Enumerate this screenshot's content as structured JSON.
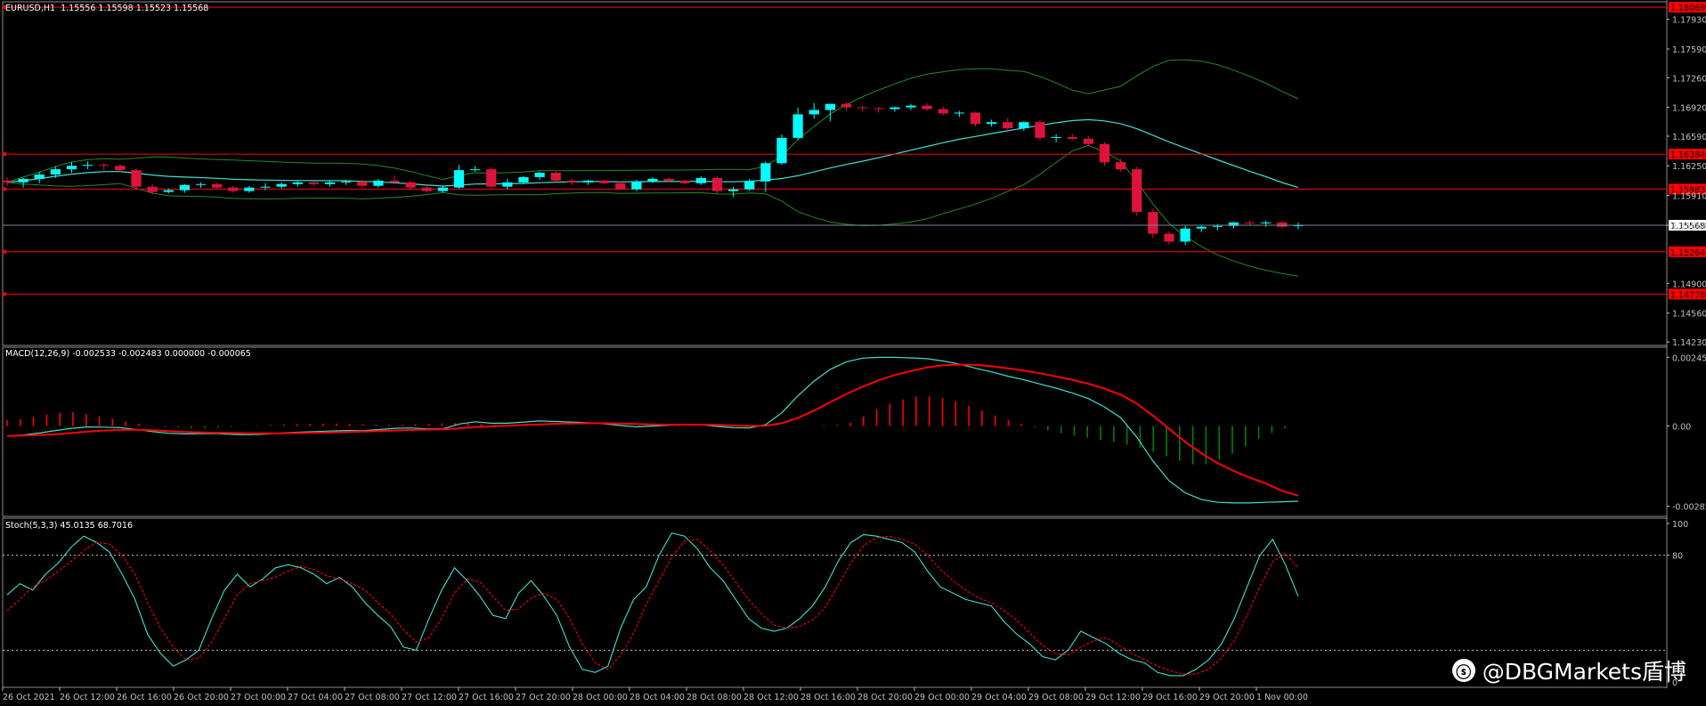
{
  "header": {
    "symbol_line": "EURUSD,H1  1.15556 1.15598 1.15523 1.15568",
    "macd_line": "MACD(12,26,9) -0.002533 -0.002483 0.000000 -0.000065",
    "stoch_line": "Stoch(5,3,3) 45.0135 68.7016"
  },
  "watermark": {
    "text": "@DBGMarkets盾博",
    "logo": "weibo-icon"
  },
  "colors": {
    "bull": "#00ffff",
    "bear": "#dc143c",
    "bands": "#228b22",
    "mid": "#40e0d0",
    "level": "#ff0000",
    "macd_hist_pos": "#ff0000",
    "macd_hist_neg": "#008000",
    "stoch_main": "#40e0d0",
    "stoch_signal": "#ff0000",
    "axis": "#c0c0c0"
  },
  "chart_data": [
    {
      "type": "candlestick",
      "title": "EURUSD,H1",
      "ylim": [
        1.1423,
        1.1807
      ],
      "y_ticks": [
        "1.17930",
        "1.17590",
        "1.17260",
        "1.16920",
        "1.16590",
        "1.16250",
        "1.15910",
        "1.15568",
        "1.14900",
        "1.14560",
        "1.14230"
      ],
      "price_label": "1.15568",
      "horizontal_levels": [
        "1.18069",
        "1.16384",
        "1.15983",
        "1.15264",
        "1.14778"
      ],
      "x_tick_labels": [
        "26 Oct 2021",
        "26 Oct 12:00",
        "26 Oct 16:00",
        "26 Oct 20:00",
        "27 Oct 00:00",
        "27 Oct 04:00",
        "27 Oct 08:00",
        "27 Oct 12:00",
        "27 Oct 16:00",
        "27 Oct 20:00",
        "28 Oct 00:00",
        "28 Oct 04:00",
        "28 Oct 08:00",
        "28 Oct 12:00",
        "28 Oct 16:00",
        "28 Oct 20:00",
        "29 Oct 00:00",
        "29 Oct 04:00",
        "29 Oct 08:00",
        "29 Oct 12:00",
        "29 Oct 16:00",
        "29 Oct 20:00",
        "1 Nov 00:00"
      ],
      "ohlc": [
        [
          1.1608,
          1.1612,
          1.1602,
          1.1606
        ],
        [
          1.1606,
          1.1611,
          1.16,
          1.161
        ],
        [
          1.161,
          1.1618,
          1.1605,
          1.1615
        ],
        [
          1.1615,
          1.1624,
          1.1611,
          1.1621
        ],
        [
          1.1621,
          1.1629,
          1.1617,
          1.1625
        ],
        [
          1.1625,
          1.163,
          1.1621,
          1.1626
        ],
        [
          1.1626,
          1.1628,
          1.162,
          1.1625
        ],
        [
          1.1625,
          1.1627,
          1.1618,
          1.162
        ],
        [
          1.162,
          1.1622,
          1.1598,
          1.1601
        ],
        [
          1.1601,
          1.1604,
          1.1592,
          1.1595
        ],
        [
          1.1595,
          1.1599,
          1.1593,
          1.1597
        ],
        [
          1.1597,
          1.1604,
          1.1594,
          1.1603
        ],
        [
          1.1603,
          1.1606,
          1.16,
          1.1604
        ],
        [
          1.1604,
          1.1606,
          1.1598,
          1.16
        ],
        [
          1.16,
          1.1602,
          1.1594,
          1.1596
        ],
        [
          1.1596,
          1.1602,
          1.1594,
          1.16
        ],
        [
          1.16,
          1.1605,
          1.1597,
          1.1601
        ],
        [
          1.1601,
          1.1606,
          1.1599,
          1.1604
        ],
        [
          1.1604,
          1.1608,
          1.1601,
          1.1606
        ],
        [
          1.1606,
          1.1608,
          1.1602,
          1.1604
        ],
        [
          1.1604,
          1.1608,
          1.1601,
          1.1606
        ],
        [
          1.1606,
          1.1609,
          1.1603,
          1.1607
        ],
        [
          1.1607,
          1.1609,
          1.16,
          1.1602
        ],
        [
          1.1602,
          1.161,
          1.16,
          1.1608
        ],
        [
          1.1608,
          1.1614,
          1.1604,
          1.1606
        ],
        [
          1.1606,
          1.1608,
          1.1598,
          1.16
        ],
        [
          1.16,
          1.1603,
          1.1594,
          1.1596
        ],
        [
          1.1596,
          1.1602,
          1.1594,
          1.16
        ],
        [
          1.16,
          1.1626,
          1.1599,
          1.162
        ],
        [
          1.162,
          1.1625,
          1.1618,
          1.1621
        ],
        [
          1.1621,
          1.1623,
          1.1599,
          1.1601
        ],
        [
          1.1601,
          1.161,
          1.1598,
          1.1606
        ],
        [
          1.1606,
          1.1613,
          1.1604,
          1.1612
        ],
        [
          1.1612,
          1.1618,
          1.1609,
          1.1617
        ],
        [
          1.1617,
          1.1618,
          1.1606,
          1.1608
        ],
        [
          1.1608,
          1.161,
          1.1603,
          1.1606
        ],
        [
          1.1606,
          1.1609,
          1.1603,
          1.1608
        ],
        [
          1.1608,
          1.1609,
          1.1604,
          1.1605
        ],
        [
          1.1605,
          1.1607,
          1.1597,
          1.1598
        ],
        [
          1.1598,
          1.1609,
          1.1596,
          1.1607
        ],
        [
          1.1607,
          1.1612,
          1.1605,
          1.161
        ],
        [
          1.161,
          1.1612,
          1.1606,
          1.1608
        ],
        [
          1.1608,
          1.1609,
          1.1604,
          1.1605
        ],
        [
          1.1605,
          1.1613,
          1.1603,
          1.1611
        ],
        [
          1.1611,
          1.1613,
          1.1593,
          1.1596
        ],
        [
          1.1596,
          1.1601,
          1.1589,
          1.1598
        ],
        [
          1.1598,
          1.161,
          1.1596,
          1.1607
        ],
        [
          1.1607,
          1.163,
          1.1595,
          1.1628
        ],
        [
          1.1628,
          1.1661,
          1.1626,
          1.1657
        ],
        [
          1.1657,
          1.1692,
          1.1655,
          1.1684
        ],
        [
          1.1684,
          1.1697,
          1.1679,
          1.1689
        ],
        [
          1.1689,
          1.1696,
          1.1676,
          1.1696
        ],
        [
          1.1696,
          1.1698,
          1.1688,
          1.1692
        ],
        [
          1.1692,
          1.1694,
          1.1687,
          1.1691
        ],
        [
          1.1691,
          1.1693,
          1.1686,
          1.169
        ],
        [
          1.169,
          1.1693,
          1.1687,
          1.1692
        ],
        [
          1.1692,
          1.1696,
          1.1689,
          1.1694
        ],
        [
          1.1694,
          1.1697,
          1.1688,
          1.169
        ],
        [
          1.169,
          1.1693,
          1.1683,
          1.1685
        ],
        [
          1.1685,
          1.1688,
          1.1681,
          1.1686
        ],
        [
          1.1686,
          1.1687,
          1.167,
          1.1673
        ],
        [
          1.1673,
          1.1678,
          1.167,
          1.1675
        ],
        [
          1.1675,
          1.168,
          1.1663,
          1.1668
        ],
        [
          1.1668,
          1.1676,
          1.1665,
          1.1675
        ],
        [
          1.1675,
          1.1678,
          1.1654,
          1.1657
        ],
        [
          1.1657,
          1.1661,
          1.1652,
          1.1658
        ],
        [
          1.1658,
          1.1662,
          1.1654,
          1.1656
        ],
        [
          1.1656,
          1.1659,
          1.1648,
          1.165
        ],
        [
          1.165,
          1.1652,
          1.1625,
          1.1629
        ],
        [
          1.1629,
          1.1633,
          1.1618,
          1.1621
        ],
        [
          1.1621,
          1.1624,
          1.1568,
          1.1572
        ],
        [
          1.1572,
          1.1576,
          1.1542,
          1.1547
        ],
        [
          1.1547,
          1.155,
          1.1535,
          1.1538
        ],
        [
          1.1538,
          1.1556,
          1.1534,
          1.1553
        ],
        [
          1.1553,
          1.1557,
          1.1549,
          1.1555
        ],
        [
          1.1555,
          1.1558,
          1.1551,
          1.1556
        ],
        [
          1.1556,
          1.1561,
          1.1553,
          1.156
        ],
        [
          1.156,
          1.1562,
          1.1556,
          1.1559
        ],
        [
          1.1559,
          1.1562,
          1.1555,
          1.156
        ],
        [
          1.156,
          1.1562,
          1.1553,
          1.1555
        ],
        [
          1.1556,
          1.15598,
          1.15523,
          1.15568
        ]
      ]
    },
    {
      "type": "macd",
      "title": "MACD(12,26,9)",
      "ylim": [
        -0.00303,
        0.00262
      ],
      "y_ticks": [
        "0.002451",
        "0.00",
        "-0.002858"
      ],
      "macd": [
        -0.00035,
        -0.00032,
        -0.00025,
        -0.00016,
        -8e-05,
        -3e-05,
        -4e-05,
        -6e-05,
        -0.00012,
        -0.0002,
        -0.00026,
        -0.00028,
        -0.00027,
        -0.00027,
        -0.0003,
        -0.00031,
        -0.00029,
        -0.00025,
        -0.00022,
        -0.0002,
        -0.00018,
        -0.00016,
        -0.00017,
        -0.00013,
        -8e-05,
        -7e-05,
        -0.0001,
        -0.0001,
        7e-05,
        0.00015,
        0.0001,
        0.0001,
        0.00014,
        0.00018,
        0.00016,
        0.00014,
        0.00012,
        8e-05,
        2e-05,
        -3e-05,
        0.0,
        3e-05,
        4e-05,
        5e-05,
        -1e-05,
        -6e-05,
        -7e-05,
        5e-05,
        0.00047,
        0.00108,
        0.0016,
        0.00202,
        0.00229,
        0.00242,
        0.00245,
        0.00245,
        0.00243,
        0.0024,
        0.00232,
        0.00221,
        0.00206,
        0.00193,
        0.00178,
        0.00165,
        0.0015,
        0.00135,
        0.00118,
        0.00098,
        0.00068,
        0.0003,
        -0.0004,
        -0.00125,
        -0.00195,
        -0.00238,
        -0.00262,
        -0.00272,
        -0.00274,
        -0.00274,
        -0.00272,
        -0.0027,
        -0.00268
      ],
      "signal": [
        -0.00035,
        -0.00034,
        -0.00032,
        -0.00029,
        -0.00025,
        -0.0002,
        -0.00016,
        -0.00014,
        -0.00013,
        -0.00015,
        -0.00018,
        -0.00021,
        -0.00023,
        -0.00024,
        -0.00025,
        -0.00026,
        -0.00026,
        -0.00026,
        -0.00025,
        -0.00024,
        -0.00023,
        -0.00021,
        -0.0002,
        -0.00018,
        -0.00016,
        -0.00014,
        -0.00013,
        -0.00012,
        -8e-05,
        -4e-05,
        -1e-05,
        1e-05,
        4e-05,
        6e-05,
        8e-05,
        9e-05,
        0.0001,
        0.0001,
        9e-05,
        7e-05,
        6e-05,
        5e-05,
        5e-05,
        5e-05,
        4e-05,
        2e-05,
        0.0,
        1e-05,
        0.0001,
        0.00029,
        0.00055,
        0.00085,
        0.00114,
        0.0014,
        0.00163,
        0.00182,
        0.00196,
        0.00209,
        0.00217,
        0.00219,
        0.00218,
        0.00213,
        0.00206,
        0.00198,
        0.00188,
        0.00177,
        0.00165,
        0.00151,
        0.00133,
        0.00112,
        0.0008,
        0.00037,
        -0.0001,
        -0.00056,
        -0.00097,
        -0.00132,
        -0.0016,
        -0.00184,
        -0.00205,
        -0.00231,
        -0.00248
      ],
      "histogram": [
        0.00021,
        0.00025,
        0.00032,
        0.00041,
        0.00047,
        0.00049,
        0.00043,
        0.00035,
        0.00026,
        0.00017,
        9e-05,
        2e-05,
        -4e-05,
        -6e-05,
        -8e-05,
        -7e-05,
        -5e-05,
        -3e-05,
        -1e-05,
        2e-05,
        4e-05,
        6e-05,
        7e-05,
        8e-05,
        9e-05,
        9e-05,
        8e-05,
        7e-05,
        6e-05,
        5e-05,
        5e-05,
        6e-05,
        8e-05,
        0.0001,
        0.00011,
        0.0001,
        8e-05,
        6e-05,
        4e-05,
        2e-05,
        1e-05,
        0.0,
        -1e-05,
        -2e-05,
        -1e-05,
        -1e-05,
        0.0,
        1e-05,
        2e-05,
        4e-05,
        3e-05,
        2e-05,
        2e-05,
        1e-05,
        0.0,
        0.0,
        1e-05,
        1e-05,
        0.0,
        -1e-05,
        -1e-05,
        0.0,
        2e-05,
        4e-05,
        0.00012,
        0.00035,
        0.0006,
        0.0008,
        0.00095,
        0.00105,
        0.00106,
        0.001,
        0.00088,
        0.00072,
        0.00055,
        0.00038,
        0.00022,
        8e-05,
        -4e-05,
        -0.00016,
        -0.00026,
        -0.00034,
        -0.00042,
        -0.0005,
        -0.00057,
        -0.00066,
        -0.00078,
        -0.00092,
        -0.00108,
        -0.00124,
        -0.00136,
        -0.00136,
        -0.0012,
        -0.00098,
        -0.00072,
        -0.00045,
        -0.00025,
        -8e-05,
        0.0
      ]
    },
    {
      "type": "stochastic",
      "title": "Stoch(5,3,3)",
      "ylim": [
        0,
        100
      ],
      "y_ticks": [
        "100",
        "80",
        "0"
      ],
      "levels": [
        80,
        20
      ],
      "main": [
        55,
        62,
        58,
        68,
        75,
        85,
        92,
        88,
        82,
        68,
        52,
        30,
        18,
        10,
        14,
        20,
        40,
        58,
        68,
        60,
        65,
        72,
        74,
        72,
        68,
        62,
        66,
        60,
        50,
        42,
        35,
        22,
        20,
        40,
        58,
        72,
        64,
        54,
        42,
        40,
        56,
        64,
        54,
        42,
        22,
        8,
        6,
        10,
        34,
        52,
        60,
        80,
        94,
        92,
        84,
        72,
        64,
        52,
        40,
        34,
        32,
        34,
        40,
        48,
        60,
        76,
        88,
        93,
        92,
        90,
        88,
        82,
        70,
        60,
        56,
        52,
        50,
        48,
        38,
        30,
        24,
        16,
        14,
        20,
        32,
        28,
        24,
        18,
        14,
        12,
        6,
        4,
        4,
        8,
        14,
        24,
        40,
        60,
        80,
        90,
        74,
        54
      ],
      "signal": [
        45,
        52,
        60,
        64,
        70,
        76,
        83,
        88,
        87,
        80,
        68,
        50,
        34,
        22,
        14,
        15,
        25,
        40,
        55,
        62,
        64,
        66,
        70,
        73,
        71,
        67,
        65,
        62,
        58,
        50,
        43,
        33,
        25,
        28,
        40,
        56,
        65,
        63,
        54,
        45,
        46,
        53,
        56,
        52,
        40,
        24,
        12,
        8,
        17,
        31,
        49,
        64,
        79,
        89,
        90,
        83,
        74,
        63,
        52,
        43,
        36,
        34,
        35,
        39,
        47,
        61,
        75,
        86,
        91,
        92,
        90,
        87,
        80,
        71,
        64,
        58,
        53,
        50,
        45,
        39,
        31,
        23,
        18,
        17,
        22,
        26,
        28,
        23,
        18,
        14,
        10,
        7,
        5,
        5,
        8,
        15,
        26,
        42,
        60,
        76,
        81,
        72
      ]
    }
  ]
}
